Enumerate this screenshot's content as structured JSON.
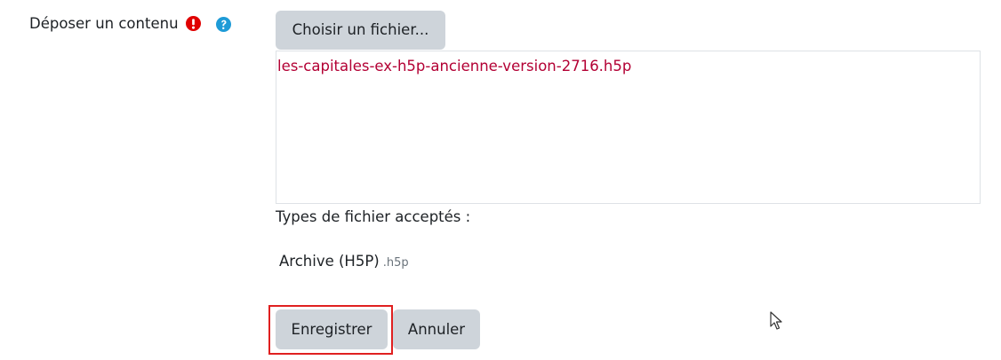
{
  "form": {
    "field_label": "Déposer un contenu",
    "required_icon": "exclamation-circle-icon",
    "help_icon": "question-circle-icon",
    "choose_file_label": "Choisir un fichier...",
    "file_name": "les-capitales-ex-h5p-ancienne-version-2716.h5p",
    "accepted_types_title": "Types de fichier acceptés :",
    "accepted_types": [
      {
        "label": "Archive (H5P)",
        "extension": ".h5p"
      }
    ],
    "save_label": "Enregistrer",
    "cancel_label": "Annuler"
  },
  "colors": {
    "required": "#e00000",
    "help": "#1e9bd7",
    "file_name": "#b30034",
    "button": "#ced4da",
    "highlight": "#e02020"
  },
  "cursor_icon": "mouse-pointer-icon"
}
